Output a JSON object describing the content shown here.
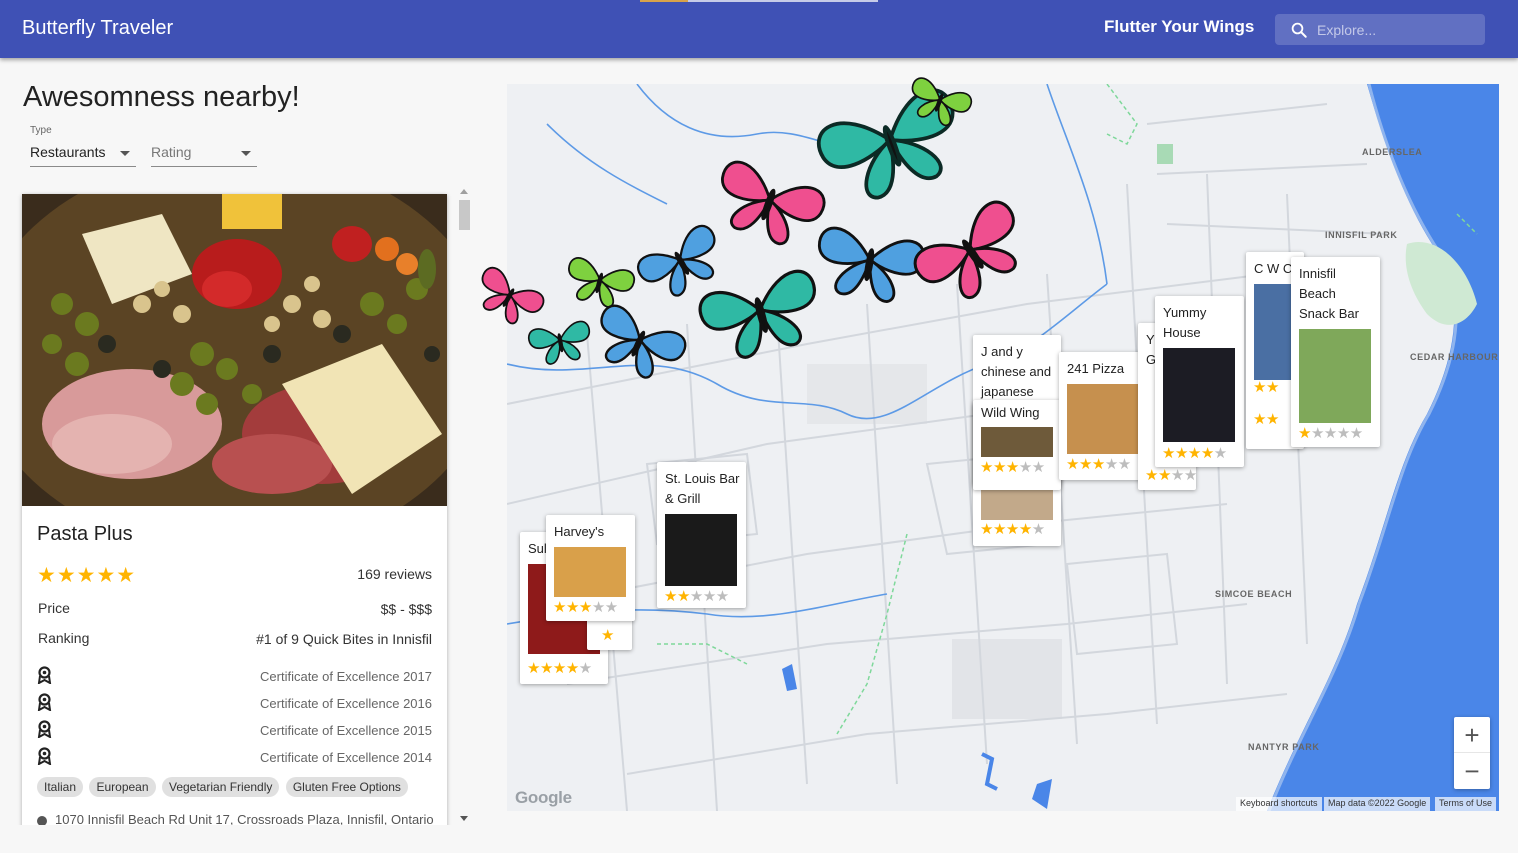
{
  "appbar": {
    "title": "Butterfly Traveler",
    "tagline": "Flutter Your Wings",
    "search_placeholder": "Explore...",
    "color": "#3f51b5"
  },
  "sidebar": {
    "title": "Awesomness nearby!",
    "type_label": "Type",
    "type_value": "Restaurants",
    "rating_placeholder": "Rating"
  },
  "listing": {
    "name": "Pasta Plus",
    "stars": "★★★★★",
    "reviews": "169 reviews",
    "price_label": "Price",
    "price_value": "$$ - $$$",
    "ranking_label": "Ranking",
    "ranking_value": "#1 of 9 Quick Bites in Innisfil",
    "awards": [
      "Certificate of Excellence 2017",
      "Certificate of Excellence 2016",
      "Certificate of Excellence 2015",
      "Certificate of Excellence 2014"
    ],
    "cuisines": [
      "Italian",
      "European",
      "Vegetarian Friendly",
      "Gluten Free Options"
    ],
    "address": "1070 Innisfil Beach Rd Unit 17, Crossroads Plaza, Innisfil, Ontario"
  },
  "map": {
    "labels": [
      "ALDERSLEA",
      "INNISFIL PARK",
      "CEDAR HARBOUR",
      "SIMCOE BEACH",
      "NANTYR PARK"
    ],
    "zoom_in": "+",
    "zoom_out": "−",
    "logo": "Google",
    "keyboard": "Keyboard shortcuts",
    "map_data": "Map data ©2022 Google",
    "terms": "Terms of Use",
    "places": [
      {
        "title": "Sul",
        "rating": 4
      },
      {
        "title": "Harvey's",
        "rating": 3
      },
      {
        "title": "St. Louis Bar & Grill",
        "rating": 2
      },
      {
        "title": "J and y chinese and japanese",
        "rating": 4
      },
      {
        "title": "Wild Wing",
        "rating": 3
      },
      {
        "title": "241 Pizza",
        "rating": 3
      },
      {
        "title": "Yc Gi",
        "rating": 2
      },
      {
        "title": "Yummy House",
        "rating": 4
      },
      {
        "title": "C W Co",
        "rating": 2
      },
      {
        "title": "Innisfil Beach Snack Bar",
        "rating": 1
      }
    ]
  }
}
